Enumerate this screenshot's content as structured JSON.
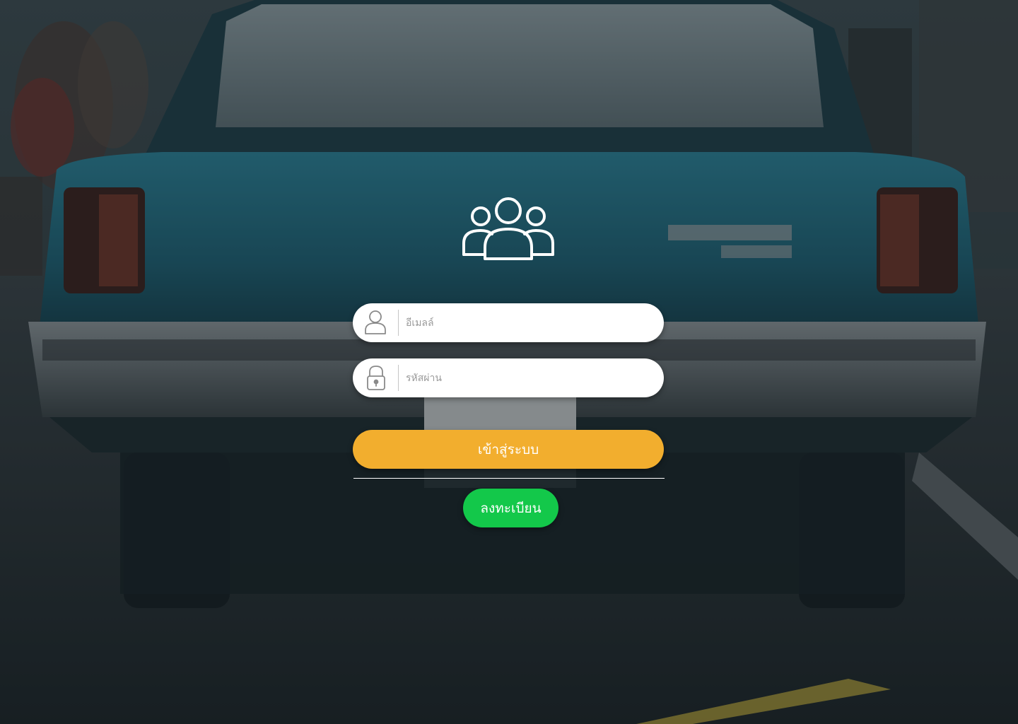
{
  "background": {
    "description_icon": "vintage-teal-car-photo",
    "overlay_color": "#1a2a30"
  },
  "header": {
    "icon": "user-group-icon"
  },
  "form": {
    "email": {
      "icon": "user-icon",
      "placeholder": "อีเมลล์",
      "value": ""
    },
    "password": {
      "icon": "lock-icon",
      "placeholder": "รหัสผ่าน",
      "value": ""
    },
    "login_label": "เข้าสู่ระบบ",
    "register_label": "ลงทะเบียน"
  },
  "colors": {
    "login_button": "#f2ae2e",
    "register_button": "#13c84a",
    "field_bg": "#ffffff"
  }
}
